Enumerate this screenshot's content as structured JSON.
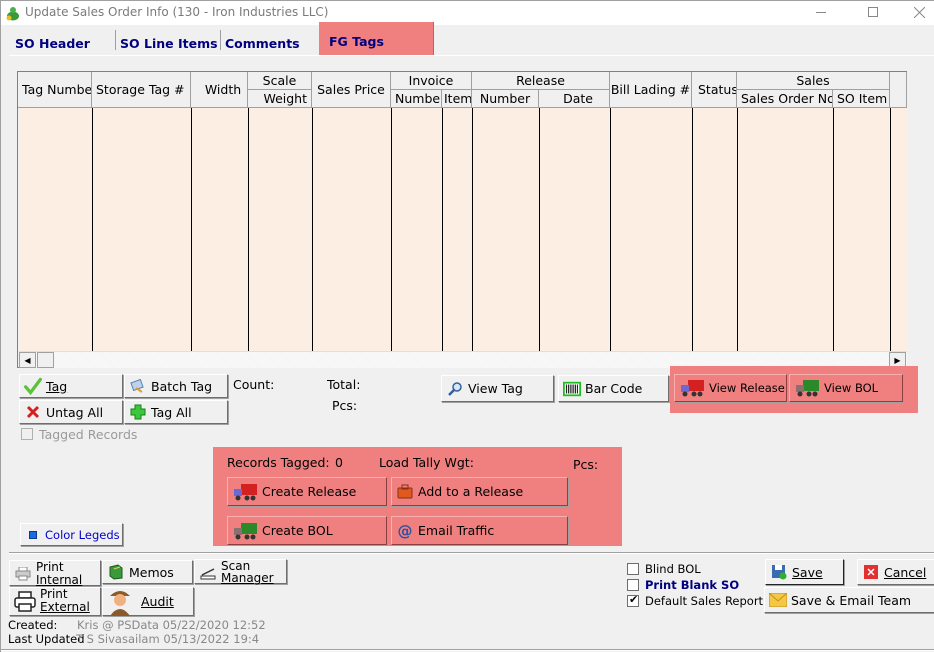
{
  "window": {
    "title": "Update Sales Order Info  (130 - Iron Industries LLC)",
    "controls": {
      "minimize": "—",
      "maximize": "☐",
      "close": "✕"
    }
  },
  "tabs": [
    {
      "label": "SO Header",
      "active": false
    },
    {
      "label": "SO Line Items",
      "active": false
    },
    {
      "label": "Comments",
      "active": false
    },
    {
      "label": "FG Tags",
      "active": true
    }
  ],
  "grid": {
    "columns": {
      "tag_number": "Tag Numbe",
      "storage_tag": "Storage Tag #",
      "width": "Width",
      "scale_group": "Scale",
      "scale_weight": "Weight",
      "sales_price": "Sales Price",
      "invoice_group": "Invoice",
      "invoice_number": "Numbe",
      "invoice_item": "Item",
      "release_group": "Release",
      "release_number": "Number",
      "release_date": "Date",
      "bill_lading": "Bill Lading #",
      "status": "Status",
      "sales_group": "Sales",
      "sales_order_no": "Sales Order No",
      "so_item": "SO Item"
    },
    "rows": [],
    "scroll_left": "◀",
    "scroll_right": "▶"
  },
  "tag_actions": {
    "tag": "Tag",
    "batch_tag": "Batch Tag",
    "untag_all": "Untag All",
    "tag_all": "Tag All",
    "tagged_records": "Tagged Records",
    "tagged_records_checked": false
  },
  "summary": {
    "count_label": "Count:",
    "total_label": "Total:",
    "pcs_label": "Pcs:"
  },
  "view_actions": {
    "view_tag": "View Tag",
    "bar_code": "Bar Code",
    "view_release": "View Release",
    "view_bol": "View BOL"
  },
  "release_panel": {
    "records_tagged_label": "Records Tagged:",
    "records_tagged_value": "0",
    "load_tally_label": "Load Tally Wgt:",
    "pcs_label": "Pcs:",
    "create_release": "Create Release",
    "add_to_release": "Add to a Release",
    "create_bol": "Create BOL",
    "email_traffic": "Email Traffic"
  },
  "color_legend": "Color Legeds",
  "footer": {
    "print_internal_1": "Print",
    "print_internal_2": "Internal",
    "print_external_1": "Print",
    "print_external_2": "External",
    "memos": "Memos",
    "audit": "Audit",
    "scan_manager_1": "Scan",
    "scan_manager_2": "Manager",
    "created_label": "Created:",
    "created_value": "Kris @ PSData 05/22/2020 12:52",
    "last_updated_label": "Last Updated",
    "last_updated_value": "T S Sivasailam 05/13/2022 19:4",
    "blind_bol": "Blind BOL",
    "blind_bol_checked": false,
    "print_blank_so": "Print Blank SO",
    "print_blank_so_checked": false,
    "default_sales_report": "Default Sales Report",
    "default_sales_report_checked": true,
    "save": "Save",
    "cancel": "Cancel",
    "save_email_team": "Save & Email Team"
  },
  "colors": {
    "highlight": "#f08080",
    "grid_body": "#fdeee4",
    "tab_text": "#000080",
    "link_blue": "#0000cc"
  }
}
